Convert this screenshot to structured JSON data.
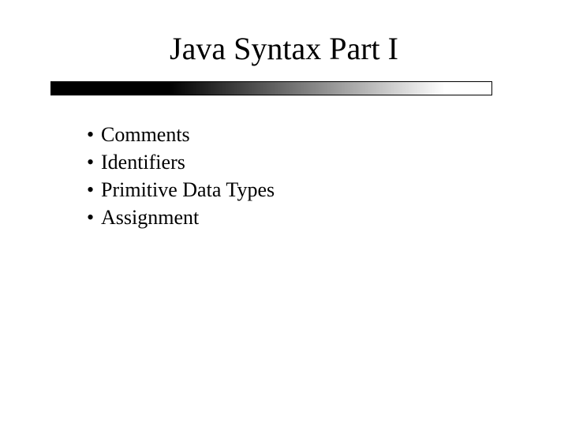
{
  "title": "Java Syntax Part I",
  "bullets": [
    "Comments",
    "Identifiers",
    "Primitive Data Types",
    "Assignment"
  ]
}
